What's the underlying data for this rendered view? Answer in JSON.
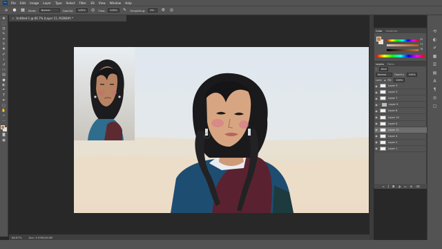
{
  "menubar": {
    "logo": "Ps",
    "items": [
      "File",
      "Edit",
      "Image",
      "Layer",
      "Type",
      "Select",
      "Filter",
      "3D",
      "View",
      "Window",
      "Help"
    ]
  },
  "options": {
    "mode_label": "Mode:",
    "mode_value": "Normal",
    "opacity_label": "Opacity:",
    "opacity_value": "100%",
    "flow_label": "Flow:",
    "flow_value": "100%",
    "smoothing_label": "Smoothing:",
    "smoothing_value": "0%"
  },
  "document": {
    "tab_title": "Untitled-1 @ 66.7% (Layer 11, RGB/8#) *",
    "close_glyph": "×"
  },
  "status": {
    "zoom": "66.67%",
    "doc_info": "Doc: 5.93M/49.8M"
  },
  "colors": {
    "foreground": "#c87a3b",
    "background": "#f0e2cf",
    "accent": "#31a8ff"
  },
  "color_panel": {
    "tabs": [
      "Color",
      "Swatches"
    ],
    "sliders": [
      {
        "name": "H",
        "value": "25"
      },
      {
        "name": "S",
        "value": "71"
      },
      {
        "name": "B",
        "value": "78"
      }
    ]
  },
  "layers_panel": {
    "tabs": [
      "Layers",
      "Paths"
    ],
    "kind_label": "Kind",
    "blend_mode": "Normal",
    "opacity_label": "Opacity:",
    "opacity_value": "100%",
    "lock_label": "Lock:",
    "fill_label": "Fill:",
    "fill_value": "100%",
    "layers": [
      {
        "name": "Layer 3",
        "type": "layer",
        "selected": false
      },
      {
        "name": "Layer 5",
        "type": "layer",
        "selected": false
      },
      {
        "name": "Layer 7",
        "type": "layer",
        "selected": false
      },
      {
        "name": "Layer 9",
        "type": "group",
        "selected": false
      },
      {
        "name": "Layer 8",
        "type": "layer",
        "selected": false
      },
      {
        "name": "Layer 10",
        "type": "layer",
        "selected": false
      },
      {
        "name": "Layer 6",
        "type": "layer",
        "selected": false
      },
      {
        "name": "Layer 11",
        "type": "layer",
        "selected": true
      },
      {
        "name": "Layer 4",
        "type": "layer",
        "selected": false
      },
      {
        "name": "Layer 2",
        "type": "layer",
        "selected": false
      },
      {
        "name": "Layer 1",
        "type": "layer",
        "selected": false
      }
    ]
  },
  "icons": {
    "eye": "visibility-eye-icon",
    "tools": [
      "move-tool-icon",
      "marquee-tool-icon",
      "lasso-tool-icon",
      "quick-select-tool-icon",
      "crop-tool-icon",
      "eyedropper-tool-icon",
      "healing-tool-icon",
      "brush-tool-icon",
      "clone-stamp-tool-icon",
      "history-brush-tool-icon",
      "eraser-tool-icon",
      "gradient-tool-icon",
      "blur-tool-icon",
      "dodge-tool-icon",
      "pen-tool-icon",
      "type-tool-icon",
      "path-select-tool-icon",
      "shape-tool-icon",
      "hand-tool-icon",
      "zoom-tool-icon",
      "more-tools-icon"
    ]
  }
}
